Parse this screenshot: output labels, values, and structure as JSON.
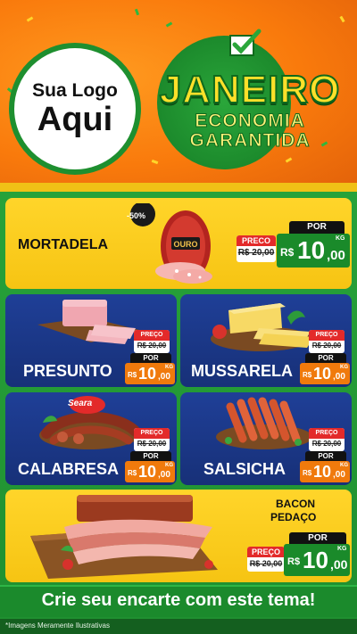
{
  "header": {
    "logo_line1": "Sua Logo",
    "logo_line2": "Aqui",
    "month": "JANEIRO",
    "tagline1": "ECONOMIA",
    "tagline2": "GARANTIDA"
  },
  "featured": {
    "name": "MORTADELA",
    "discount": "-50%",
    "brand": "OURO",
    "preco_label": "PRECO",
    "old_price": "R$ 20,00",
    "por_label": "POR",
    "currency": "R$",
    "price_int": "10",
    "price_dec": ",00",
    "unit": "KG"
  },
  "products": [
    {
      "name": "PRESUNTO",
      "preco_label": "PREÇO",
      "old_price": "R$ 20,00",
      "por_label": "POR",
      "currency": "R$",
      "price_int": "10",
      "price_dec": ",00",
      "unit": "KG"
    },
    {
      "name": "MUSSARELA",
      "preco_label": "PREÇO",
      "old_price": "R$ 20,00",
      "por_label": "POR",
      "currency": "R$",
      "price_int": "10",
      "price_dec": ",00",
      "unit": "KG"
    },
    {
      "name": "CALABRESA",
      "brand": "Seara",
      "preco_label": "PREÇO",
      "old_price": "R$ 20,00",
      "por_label": "POR",
      "currency": "R$",
      "price_int": "10",
      "price_dec": ",00",
      "unit": "KG"
    },
    {
      "name": "SALSICHA",
      "preco_label": "PREÇO",
      "old_price": "R$ 20,00",
      "por_label": "POR",
      "currency": "R$",
      "price_int": "10",
      "price_dec": ",00",
      "unit": "KG"
    }
  ],
  "bacon": {
    "name_line1": "BACON",
    "name_line2": "PEDAÇO",
    "preco_label": "PREÇO",
    "old_price": "R$ 20,00",
    "por_label": "POR",
    "currency": "R$",
    "price_int": "10",
    "price_dec": ",00",
    "unit": "KG"
  },
  "footer": {
    "cta": "Crie seu encarte com este tema!",
    "disclaimer": "*Imagens Meramente Ilustrativas"
  },
  "colors": {
    "header_orange": "#f97a0c",
    "brand_green": "#1e8f2f",
    "card_yellow": "#ffd52a",
    "card_blue": "#1f3f97",
    "price_orange": "#f07a0c",
    "tag_red": "#e32a2a"
  }
}
